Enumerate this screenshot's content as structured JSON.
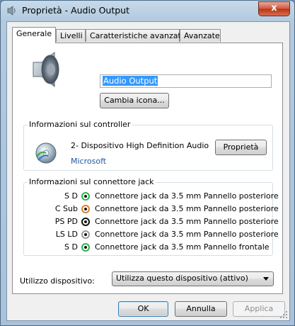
{
  "window": {
    "title": "Proprietà - Audio Output",
    "close_label": "x"
  },
  "tabs": [
    {
      "label": "Generale",
      "active": true
    },
    {
      "label": "Livelli",
      "active": false
    },
    {
      "label": "Caratteristiche avanzate",
      "active": false
    },
    {
      "label": "Avanzate",
      "active": false
    }
  ],
  "general": {
    "device_icon": "speaker-icon",
    "name_value": "Audio Output",
    "change_icon_button": "Cambia icona..."
  },
  "controller": {
    "title": "Informazioni sul controller",
    "name": "2- Dispositivo High Definition Audio",
    "maker": "Microsoft",
    "properties_button": "Proprietà",
    "icon": "audio-controller-icon"
  },
  "jack": {
    "title": "Informazioni sul connettore jack",
    "rows": [
      {
        "channel": "S D",
        "description": "Connettore jack da 3.5 mm Pannello posteriore",
        "color": "#2db34a"
      },
      {
        "channel": "C Sub",
        "description": "Connettore jack da 3.5 mm Pannello posteriore",
        "color": "#d9822b"
      },
      {
        "channel": "PS PD",
        "description": "Connettore jack da 3.5 mm Pannello posteriore",
        "color": "#111111"
      },
      {
        "channel": "LS LD",
        "description": "Connettore jack da 3.5 mm Pannello posteriore",
        "color": "#9a9a9a"
      },
      {
        "channel": "S D",
        "description": "Connettore jack da 3.5 mm Pannello frontale",
        "color": "#2db34a"
      }
    ]
  },
  "usage": {
    "label": "Utilizzo dispositivo:",
    "selected": "Utilizza questo dispositivo (attivo)"
  },
  "footer": {
    "ok": "OK",
    "cancel": "Annulla",
    "apply": "Applica"
  }
}
